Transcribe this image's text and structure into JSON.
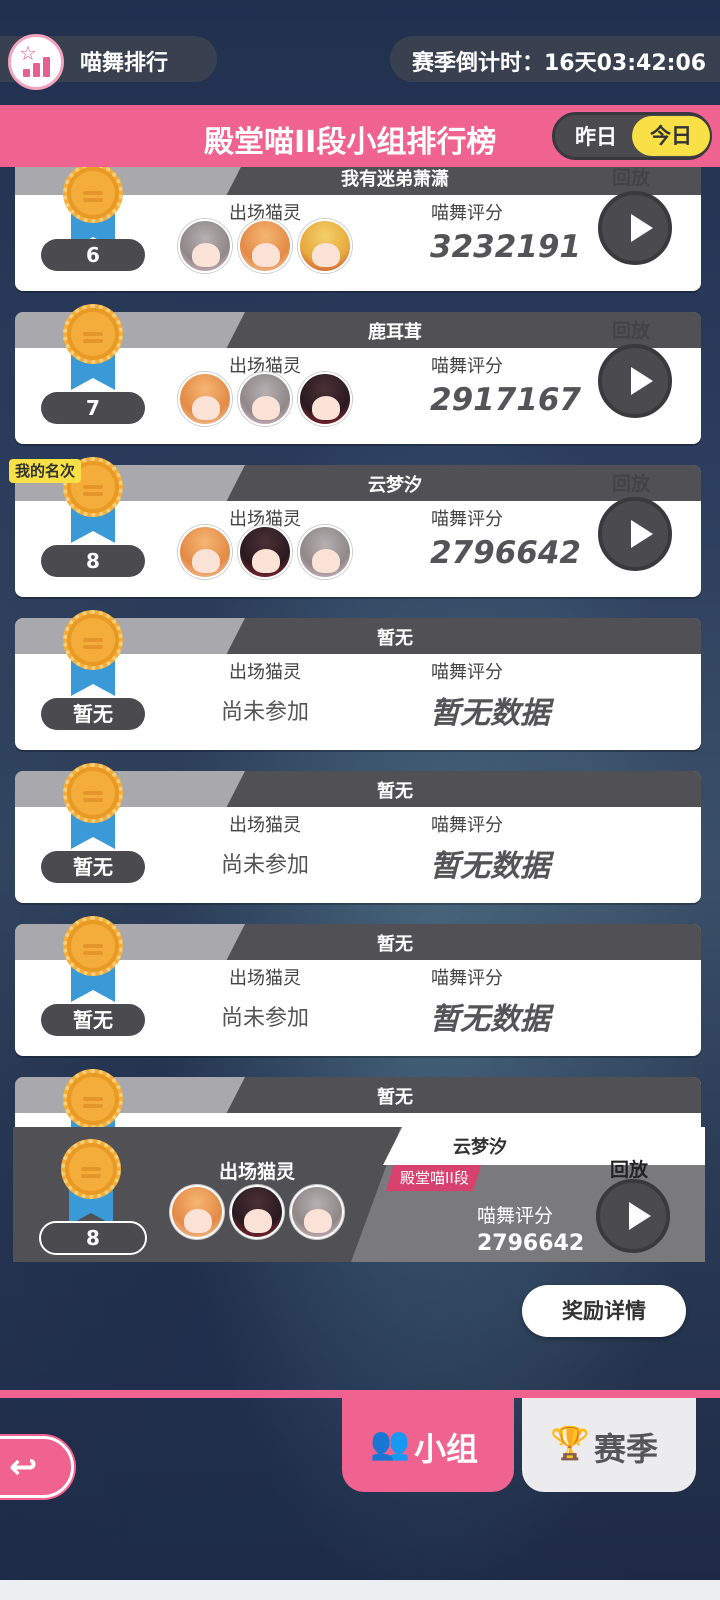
{
  "header": {
    "title": "喵舞排行",
    "countdown": "赛季倒计时：16天03:42:06"
  },
  "leaderboard": {
    "title": "殿堂喵II段小组排行榜",
    "toggle": {
      "yesterday": "昨日",
      "today": "今日",
      "selected": "今日"
    }
  },
  "labels": {
    "cats": "出场猫灵",
    "score": "喵舞评分",
    "replay": "回放",
    "my_rank": "我的名次",
    "not_joined": "尚未参加",
    "no_data": "暂无数据"
  },
  "entries": [
    {
      "name": "我有迷弟萧潇",
      "rank": "6",
      "score": "3232191",
      "cats": [
        "grey-pink-cat",
        "orange-hair-cat",
        "blonde-red-cat"
      ]
    },
    {
      "name": "鹿耳茸",
      "rank": "7",
      "score": "2917167",
      "cats": [
        "orange-hair-cat",
        "grey-pink-cat",
        "dark-hair-cat"
      ]
    },
    {
      "name": "云梦汐",
      "rank": "8",
      "score": "2796642",
      "cats": [
        "orange-hair-cat",
        "dark-hair-cat",
        "grey-pink-cat"
      ],
      "is_me": true
    },
    {
      "name": "暂无",
      "rank": "暂无"
    },
    {
      "name": "暂无",
      "rank": "暂无"
    },
    {
      "name": "暂无",
      "rank": "暂无"
    },
    {
      "name": "暂无",
      "rank": ""
    }
  ],
  "me": {
    "name": "云梦汐",
    "tier": "殿堂喵II段",
    "rank": "8",
    "score": "2796642",
    "cats_label": "出场猫灵",
    "score_label": "喵舞评分",
    "replay": "回放"
  },
  "reward_button": "奖励详情",
  "tabs": {
    "group": "小组",
    "season": "赛季",
    "active": "小组"
  },
  "colors": {
    "accent_pink": "#f0628f",
    "toggle_yellow": "#f8e046",
    "card_dark": "#505055",
    "medal_gold": "#f4ad3a",
    "ribbon_blue": "#3a9ad8"
  }
}
